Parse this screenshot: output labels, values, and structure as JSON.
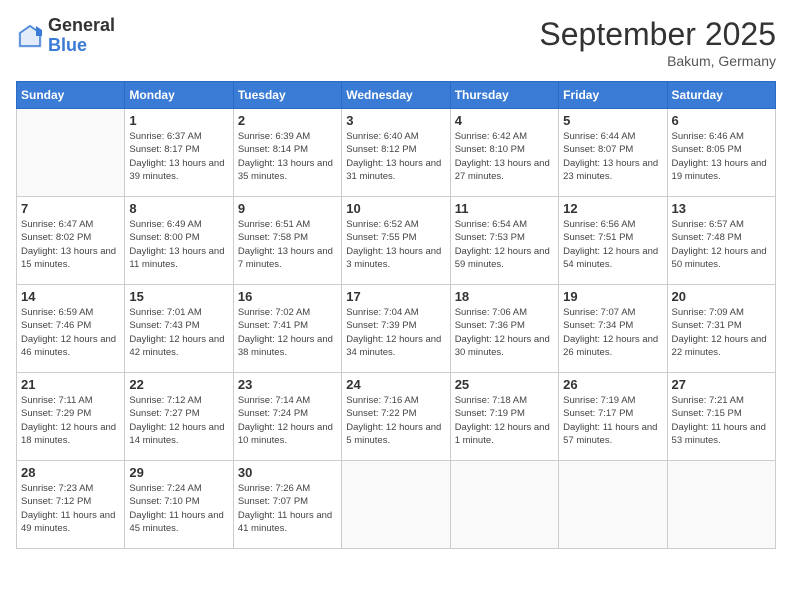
{
  "header": {
    "logo_general": "General",
    "logo_blue": "Blue",
    "month_title": "September 2025",
    "location": "Bakum, Germany"
  },
  "days_of_week": [
    "Sunday",
    "Monday",
    "Tuesday",
    "Wednesday",
    "Thursday",
    "Friday",
    "Saturday"
  ],
  "weeks": [
    [
      {
        "day": "",
        "sunrise": "",
        "sunset": "",
        "daylight": ""
      },
      {
        "day": "1",
        "sunrise": "Sunrise: 6:37 AM",
        "sunset": "Sunset: 8:17 PM",
        "daylight": "Daylight: 13 hours and 39 minutes."
      },
      {
        "day": "2",
        "sunrise": "Sunrise: 6:39 AM",
        "sunset": "Sunset: 8:14 PM",
        "daylight": "Daylight: 13 hours and 35 minutes."
      },
      {
        "day": "3",
        "sunrise": "Sunrise: 6:40 AM",
        "sunset": "Sunset: 8:12 PM",
        "daylight": "Daylight: 13 hours and 31 minutes."
      },
      {
        "day": "4",
        "sunrise": "Sunrise: 6:42 AM",
        "sunset": "Sunset: 8:10 PM",
        "daylight": "Daylight: 13 hours and 27 minutes."
      },
      {
        "day": "5",
        "sunrise": "Sunrise: 6:44 AM",
        "sunset": "Sunset: 8:07 PM",
        "daylight": "Daylight: 13 hours and 23 minutes."
      },
      {
        "day": "6",
        "sunrise": "Sunrise: 6:46 AM",
        "sunset": "Sunset: 8:05 PM",
        "daylight": "Daylight: 13 hours and 19 minutes."
      }
    ],
    [
      {
        "day": "7",
        "sunrise": "Sunrise: 6:47 AM",
        "sunset": "Sunset: 8:02 PM",
        "daylight": "Daylight: 13 hours and 15 minutes."
      },
      {
        "day": "8",
        "sunrise": "Sunrise: 6:49 AM",
        "sunset": "Sunset: 8:00 PM",
        "daylight": "Daylight: 13 hours and 11 minutes."
      },
      {
        "day": "9",
        "sunrise": "Sunrise: 6:51 AM",
        "sunset": "Sunset: 7:58 PM",
        "daylight": "Daylight: 13 hours and 7 minutes."
      },
      {
        "day": "10",
        "sunrise": "Sunrise: 6:52 AM",
        "sunset": "Sunset: 7:55 PM",
        "daylight": "Daylight: 13 hours and 3 minutes."
      },
      {
        "day": "11",
        "sunrise": "Sunrise: 6:54 AM",
        "sunset": "Sunset: 7:53 PM",
        "daylight": "Daylight: 12 hours and 59 minutes."
      },
      {
        "day": "12",
        "sunrise": "Sunrise: 6:56 AM",
        "sunset": "Sunset: 7:51 PM",
        "daylight": "Daylight: 12 hours and 54 minutes."
      },
      {
        "day": "13",
        "sunrise": "Sunrise: 6:57 AM",
        "sunset": "Sunset: 7:48 PM",
        "daylight": "Daylight: 12 hours and 50 minutes."
      }
    ],
    [
      {
        "day": "14",
        "sunrise": "Sunrise: 6:59 AM",
        "sunset": "Sunset: 7:46 PM",
        "daylight": "Daylight: 12 hours and 46 minutes."
      },
      {
        "day": "15",
        "sunrise": "Sunrise: 7:01 AM",
        "sunset": "Sunset: 7:43 PM",
        "daylight": "Daylight: 12 hours and 42 minutes."
      },
      {
        "day": "16",
        "sunrise": "Sunrise: 7:02 AM",
        "sunset": "Sunset: 7:41 PM",
        "daylight": "Daylight: 12 hours and 38 minutes."
      },
      {
        "day": "17",
        "sunrise": "Sunrise: 7:04 AM",
        "sunset": "Sunset: 7:39 PM",
        "daylight": "Daylight: 12 hours and 34 minutes."
      },
      {
        "day": "18",
        "sunrise": "Sunrise: 7:06 AM",
        "sunset": "Sunset: 7:36 PM",
        "daylight": "Daylight: 12 hours and 30 minutes."
      },
      {
        "day": "19",
        "sunrise": "Sunrise: 7:07 AM",
        "sunset": "Sunset: 7:34 PM",
        "daylight": "Daylight: 12 hours and 26 minutes."
      },
      {
        "day": "20",
        "sunrise": "Sunrise: 7:09 AM",
        "sunset": "Sunset: 7:31 PM",
        "daylight": "Daylight: 12 hours and 22 minutes."
      }
    ],
    [
      {
        "day": "21",
        "sunrise": "Sunrise: 7:11 AM",
        "sunset": "Sunset: 7:29 PM",
        "daylight": "Daylight: 12 hours and 18 minutes."
      },
      {
        "day": "22",
        "sunrise": "Sunrise: 7:12 AM",
        "sunset": "Sunset: 7:27 PM",
        "daylight": "Daylight: 12 hours and 14 minutes."
      },
      {
        "day": "23",
        "sunrise": "Sunrise: 7:14 AM",
        "sunset": "Sunset: 7:24 PM",
        "daylight": "Daylight: 12 hours and 10 minutes."
      },
      {
        "day": "24",
        "sunrise": "Sunrise: 7:16 AM",
        "sunset": "Sunset: 7:22 PM",
        "daylight": "Daylight: 12 hours and 5 minutes."
      },
      {
        "day": "25",
        "sunrise": "Sunrise: 7:18 AM",
        "sunset": "Sunset: 7:19 PM",
        "daylight": "Daylight: 12 hours and 1 minute."
      },
      {
        "day": "26",
        "sunrise": "Sunrise: 7:19 AM",
        "sunset": "Sunset: 7:17 PM",
        "daylight": "Daylight: 11 hours and 57 minutes."
      },
      {
        "day": "27",
        "sunrise": "Sunrise: 7:21 AM",
        "sunset": "Sunset: 7:15 PM",
        "daylight": "Daylight: 11 hours and 53 minutes."
      }
    ],
    [
      {
        "day": "28",
        "sunrise": "Sunrise: 7:23 AM",
        "sunset": "Sunset: 7:12 PM",
        "daylight": "Daylight: 11 hours and 49 minutes."
      },
      {
        "day": "29",
        "sunrise": "Sunrise: 7:24 AM",
        "sunset": "Sunset: 7:10 PM",
        "daylight": "Daylight: 11 hours and 45 minutes."
      },
      {
        "day": "30",
        "sunrise": "Sunrise: 7:26 AM",
        "sunset": "Sunset: 7:07 PM",
        "daylight": "Daylight: 11 hours and 41 minutes."
      },
      {
        "day": "",
        "sunrise": "",
        "sunset": "",
        "daylight": ""
      },
      {
        "day": "",
        "sunrise": "",
        "sunset": "",
        "daylight": ""
      },
      {
        "day": "",
        "sunrise": "",
        "sunset": "",
        "daylight": ""
      },
      {
        "day": "",
        "sunrise": "",
        "sunset": "",
        "daylight": ""
      }
    ]
  ]
}
